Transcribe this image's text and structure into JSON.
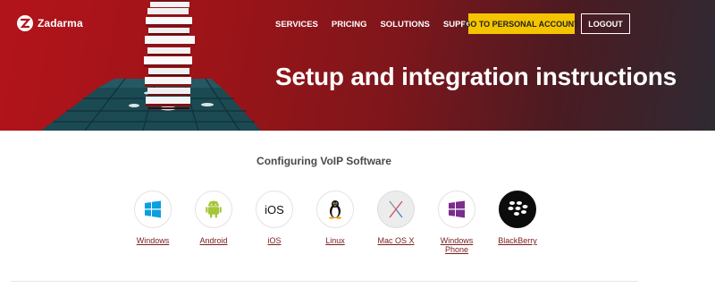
{
  "header": {
    "logo_text": "Zadarma",
    "nav": [
      "SERVICES",
      "PRICING",
      "SOLUTIONS",
      "SUPPORT"
    ],
    "account_button": "GO TO PERSONAL ACCOUNT",
    "logout_button": "LOGOUT",
    "title": "Setup and integration instructions"
  },
  "main": {
    "section_title": "Configuring VoIP Software",
    "platforms": [
      {
        "label": "Windows",
        "icon": "windows-icon"
      },
      {
        "label": "Android",
        "icon": "android-icon"
      },
      {
        "label": "iOS",
        "icon": "ios-icon"
      },
      {
        "label": "Linux",
        "icon": "linux-icon"
      },
      {
        "label": "Mac OS X",
        "icon": "mac-os-x-icon"
      },
      {
        "label": "Windows Phone",
        "icon": "windows-phone-icon"
      },
      {
        "label": "BlackBerry",
        "icon": "blackberry-icon"
      }
    ]
  },
  "colors": {
    "brand_red": "#b3141b",
    "accent_yellow": "#f5c400",
    "link_color": "#7b2020",
    "windows_blue": "#0aa0e0",
    "android_green": "#a4c639",
    "windows_phone_purple": "#7a2d8c"
  }
}
